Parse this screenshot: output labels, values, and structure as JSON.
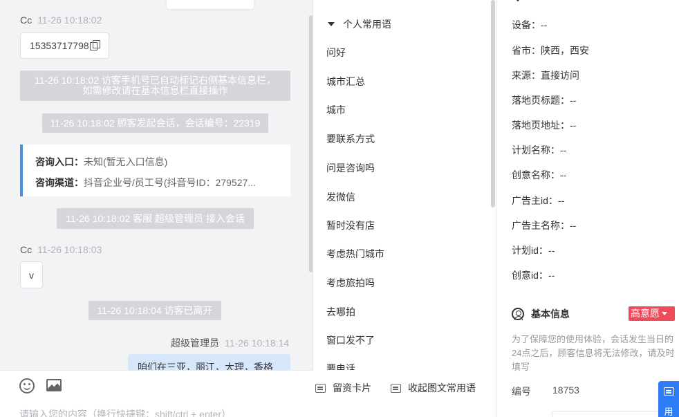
{
  "chat": {
    "messages": [
      {
        "sender": "Cc",
        "time": "11-26 10:18:02",
        "text": "15353717798"
      },
      {
        "system": "11-26 10:18:02 访客手机号已自动标记右侧基本信息栏，",
        "system2": "如需修改请在基本信息栏直接操作"
      },
      {
        "system": "11-26 10:18:02 顾客发起会话，会话编号：22319"
      },
      {
        "system": "11-26 10:18:02 客服 超级管理员 接入会话"
      },
      {
        "sender": "Cc",
        "time": "11-26 10:18:03",
        "text": "v"
      },
      {
        "system": "11-26 10:18:04 访客已离开"
      },
      {
        "sender": "超级管理员",
        "time": "11-26 10:18:14",
        "text": "咱们在三亚，丽江，大理，香格"
      }
    ],
    "info_card": {
      "entry_label": "咨询入口：",
      "entry_value": "未知(暂无入口信息)",
      "channel_label": "咨询渠道：",
      "channel_value": "抖音企业号/员工号(抖音号ID：279527..."
    },
    "input_placeholder": "请输入您的内容（换行快捷键：shift/ctrl + enter）"
  },
  "phrases": {
    "header": "个人常用语",
    "items": [
      "问好",
      "城市汇总",
      "城市",
      "要联系方式",
      "问是咨询吗",
      "发微信",
      "暂时没有店",
      "考虑热门城市",
      "考虑旅拍吗",
      "去哪拍",
      "窗口发不了",
      "要电话"
    ],
    "card_button": "留资卡片",
    "collapse_button": "收起图文常用语"
  },
  "info": {
    "rows": [
      {
        "label": "设备：",
        "value": "--"
      },
      {
        "label": "省市：",
        "value": "陕西，西安"
      },
      {
        "label": "来源：",
        "value": "直接访问"
      },
      {
        "label": "落地页标题：",
        "value": "--"
      },
      {
        "label": "落地页地址：",
        "value": "--"
      },
      {
        "label": "计划名称：",
        "value": "--"
      },
      {
        "label": "创意名称：",
        "value": "--"
      },
      {
        "label": "广告主id：",
        "value": "--"
      },
      {
        "label": "广告主名称：",
        "value": "--"
      },
      {
        "label": "计划id：",
        "value": "--"
      },
      {
        "label": "创意id：",
        "value": "--"
      }
    ],
    "basic_title": "基本信息",
    "intent_badge": "高意愿",
    "notice": "为了保障您的使用体验，会话发生当日的24点之后，顾客信息将无法修改，请及时填写",
    "id_label": "编号",
    "id_value": "18753",
    "side_label": "用"
  },
  "colors": {
    "accent": "#4a90e2",
    "agent_bubble": "#d6e6fb",
    "system_bg": "#d4d6da",
    "badge_red": "#f04b5a",
    "float_blue": "#2f7df6"
  }
}
